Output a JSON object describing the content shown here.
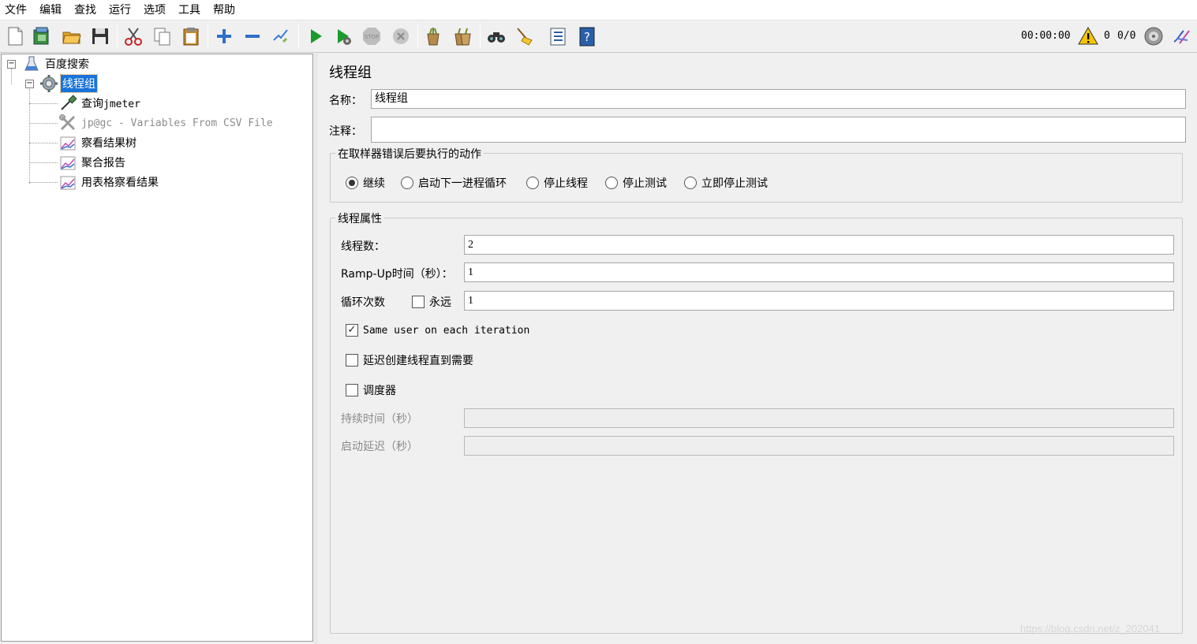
{
  "menu": [
    "文件",
    "编辑",
    "查找",
    "运行",
    "选项",
    "工具",
    "帮助"
  ],
  "toolbar": {
    "icons": [
      "new-icon",
      "templates-icon",
      "open-icon",
      "save-icon",
      "cut-icon",
      "copy-icon",
      "paste-icon",
      "expand-icon",
      "collapse-icon",
      "toggle-icon",
      "start-icon",
      "start-no-pause-icon",
      "stop-icon",
      "shutdown-icon",
      "clear-icon",
      "clear-all-icon",
      "search-icon",
      "reset-search-icon",
      "function-helper-icon",
      "help-icon"
    ],
    "timer": "00:00:00",
    "warning_count": "0",
    "threads": "0/0"
  },
  "tree": {
    "root": "百度搜索",
    "thread_group": "线程组",
    "children": [
      {
        "prefix": "查询",
        "suffix": "jmeter"
      },
      {
        "label": "jp@gc - Variables From CSV File"
      },
      {
        "label": "察看结果树"
      },
      {
        "label": "聚合报告"
      },
      {
        "label": "用表格察看结果"
      }
    ]
  },
  "panel": {
    "title": "线程组",
    "name_label": "名称：",
    "name_value": "线程组",
    "comment_label": "注释：",
    "comment_value": "",
    "error_group_title": "在取样器错误后要执行的动作",
    "error_actions": [
      {
        "label": "继续",
        "selected": true
      },
      {
        "label": "启动下一进程循环",
        "selected": false
      },
      {
        "label": "停止线程",
        "selected": false
      },
      {
        "label": "停止测试",
        "selected": false
      },
      {
        "label": "立即停止测试",
        "selected": false
      }
    ],
    "props_group_title": "线程属性",
    "threads_label": "线程数：",
    "threads_value": "2",
    "rampup_label": "Ramp-Up时间（秒）：",
    "rampup_value": "1",
    "loop_label": "循环次数",
    "forever_label": "永远",
    "forever_checked": false,
    "loop_value": "1",
    "same_user_label": "Same user on each iteration",
    "same_user_checked": true,
    "delay_create_label": "延迟创建线程直到需要",
    "delay_create_checked": false,
    "scheduler_label": "调度器",
    "scheduler_checked": false,
    "duration_label": "持续时间（秒）",
    "duration_value": "",
    "startup_delay_label": "启动延迟（秒）",
    "startup_delay_value": ""
  },
  "watermark": "https://blog.csdn.net/z_202041"
}
